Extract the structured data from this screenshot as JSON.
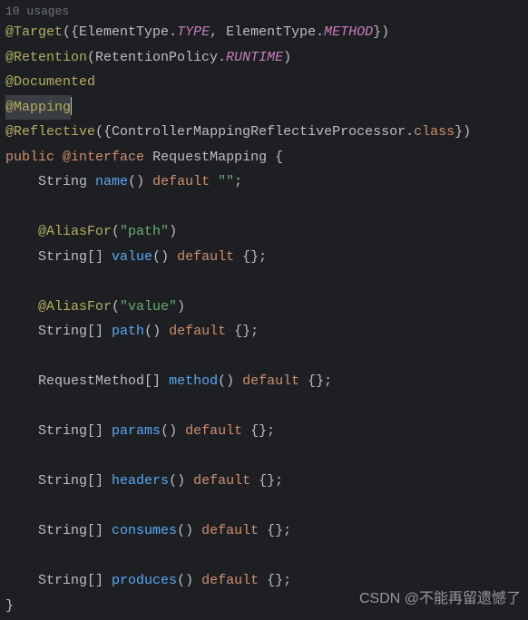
{
  "usages": "10 usages",
  "ann": {
    "target": "@Target",
    "retention": "@Retention",
    "documented": "@Documented",
    "mapping": "@Mapping",
    "reflective": "@Reflective",
    "aliasfor": "@AliasFor"
  },
  "sym": {
    "elemtype": "ElementType",
    "type_const": "TYPE",
    "method_const": "METHOD",
    "retpolicy": "RetentionPolicy",
    "runtime": "RUNTIME",
    "cmrp": "ControllerMappingReflectiveProcessor",
    "class_kw": "class",
    "public": "public",
    "at_interface": "@interface",
    "requestmapping": "RequestMapping",
    "string": "String",
    "stringarr": "String[]",
    "reqmethodarr": "RequestMethod[]",
    "default": "default",
    "empty_str": "\"\"",
    "empty_arr": "{}",
    "path_str": "\"path\"",
    "value_str": "\"value\""
  },
  "methods": {
    "name": "name",
    "value": "value",
    "path": "path",
    "method": "method",
    "params": "params",
    "headers": "headers",
    "consumes": "consumes",
    "produces": "produces"
  },
  "watermark": "CSDN @不能再留遗憾了"
}
